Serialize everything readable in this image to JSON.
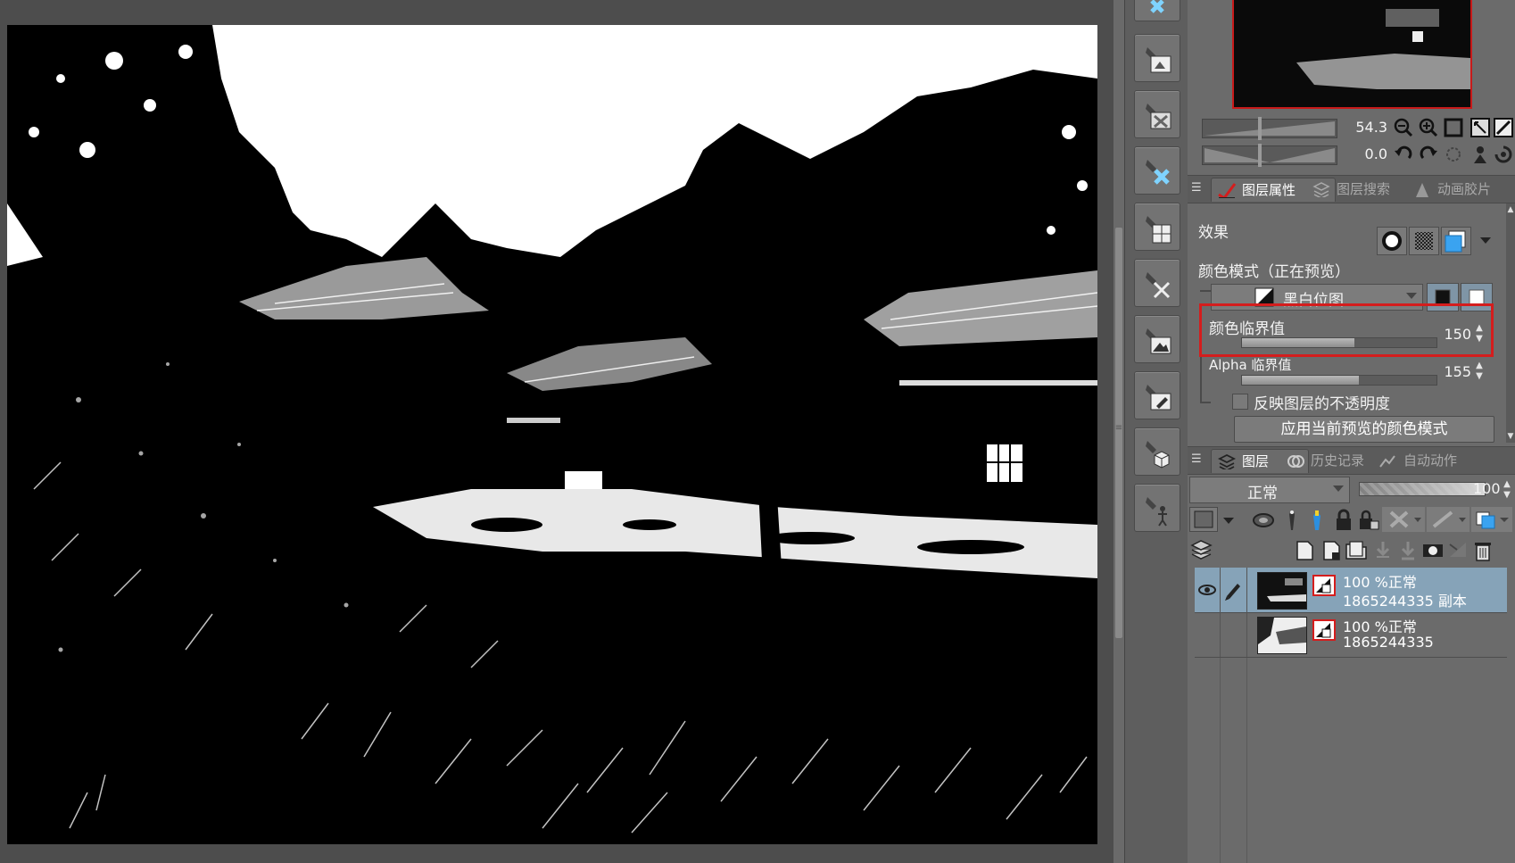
{
  "navigator": {
    "zoom_value": "54.3",
    "rotate_value": "0.0"
  },
  "top_tabs": [
    {
      "label": "图层属性",
      "active": true
    },
    {
      "label": "图层搜索",
      "active": false
    },
    {
      "label": "动画胶片",
      "active": false
    }
  ],
  "properties": {
    "effect_label": "效果",
    "color_mode_label": "颜色模式（正在预览）",
    "color_mode_value": "黑白位图",
    "color_threshold_label": "颜色临界值",
    "color_threshold_value": "150",
    "color_threshold_fraction": 0.58,
    "alpha_threshold_label": "Alpha 临界值",
    "alpha_threshold_value": "155",
    "alpha_threshold_fraction": 0.6,
    "reflect_opacity_label": "反映图层的不透明度",
    "apply_button_label": "应用当前预览的颜色模式"
  },
  "bottom_tabs": [
    {
      "label": "图层",
      "active": true
    },
    {
      "label": "历史记录",
      "active": false
    },
    {
      "label": "自动动作",
      "active": false
    }
  ],
  "layers_panel": {
    "blend_mode": "正常",
    "opacity_value": "100"
  },
  "layers": [
    {
      "line1": "100 %正常",
      "line2": "1865244335 副本",
      "selected": true,
      "visible": true
    },
    {
      "line1": "100 %正常",
      "line2": "1865244335",
      "selected": false,
      "visible": false
    }
  ],
  "colors": {
    "highlight_red": "#d41d1d",
    "selection_blue": "#86a3b8",
    "panel_gray": "#6b6b6b"
  }
}
